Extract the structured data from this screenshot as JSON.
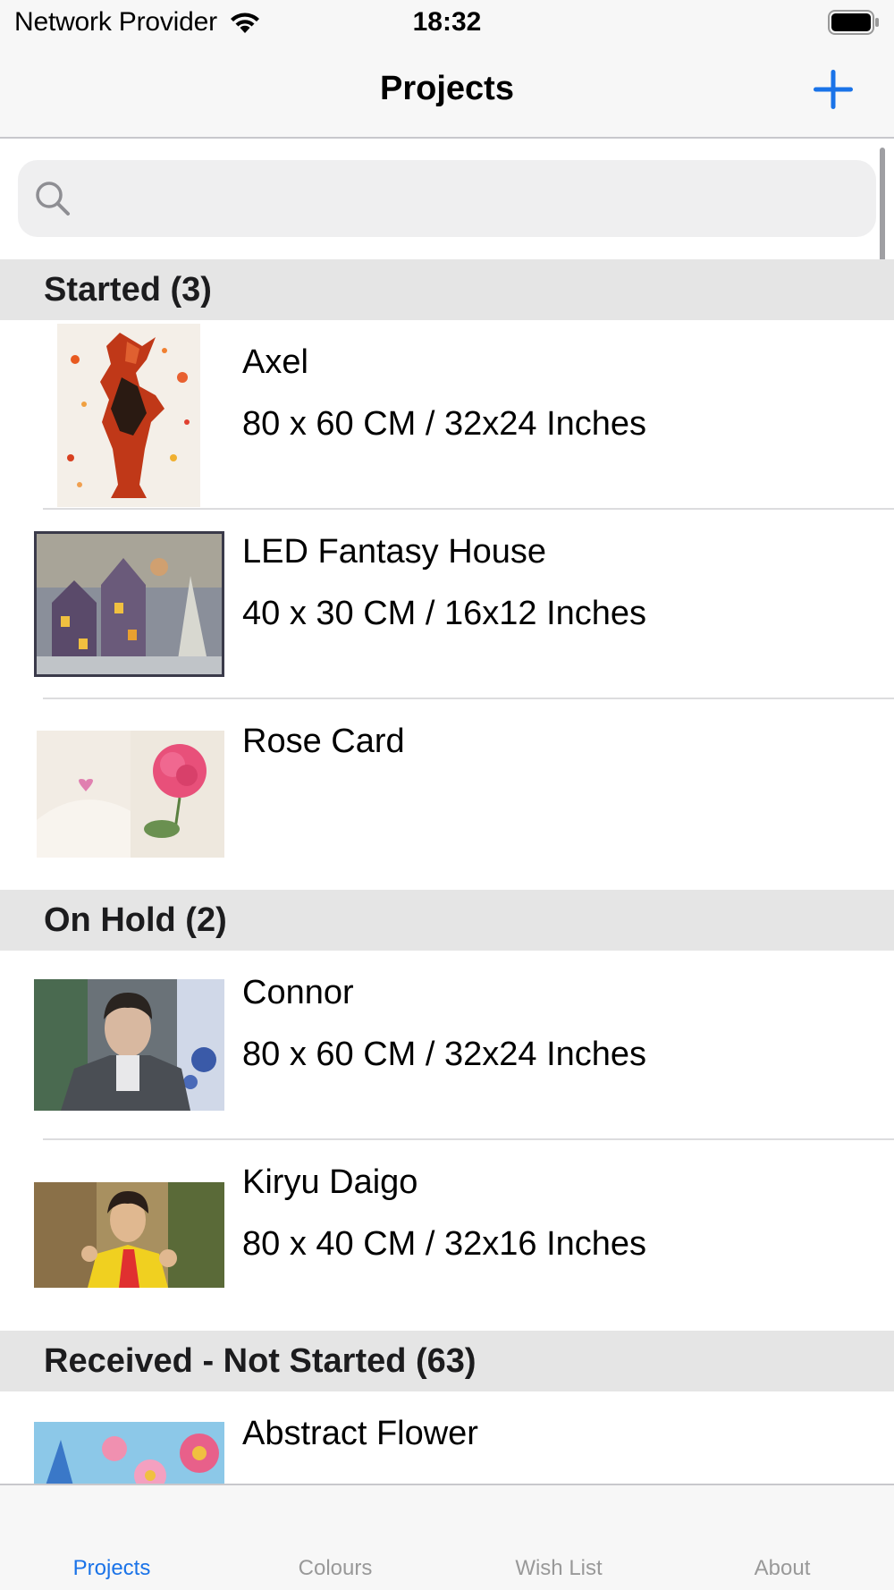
{
  "status_bar": {
    "carrier": "Network Provider",
    "time": "18:32"
  },
  "nav": {
    "title": "Projects",
    "add_icon": "plus-icon"
  },
  "search": {
    "placeholder": ""
  },
  "colors": {
    "accent": "#1a73e8",
    "section_bg": "#e5e5e5",
    "bar_bg": "#f7f7f7"
  },
  "sections": [
    {
      "header": "Started (3)",
      "items": [
        {
          "title": "Axel",
          "subtitle": "80 x 60 CM / 32x24 Inches"
        },
        {
          "title": "LED Fantasy House",
          "subtitle": "40 x 30 CM / 16x12 Inches"
        },
        {
          "title": "Rose Card",
          "subtitle": ""
        }
      ]
    },
    {
      "header": "On Hold (2)",
      "items": [
        {
          "title": "Connor",
          "subtitle": "80 x 60 CM / 32x24 Inches"
        },
        {
          "title": "Kiryu Daigo",
          "subtitle": "80 x 40 CM / 32x16 Inches"
        }
      ]
    },
    {
      "header": "Received - Not Started (63)",
      "items": [
        {
          "title": "Abstract Flower",
          "subtitle": ""
        }
      ]
    }
  ],
  "tabs": [
    {
      "label": "Projects",
      "active": true
    },
    {
      "label": "Colours",
      "active": false
    },
    {
      "label": "Wish List",
      "active": false
    },
    {
      "label": "About",
      "active": false
    }
  ]
}
